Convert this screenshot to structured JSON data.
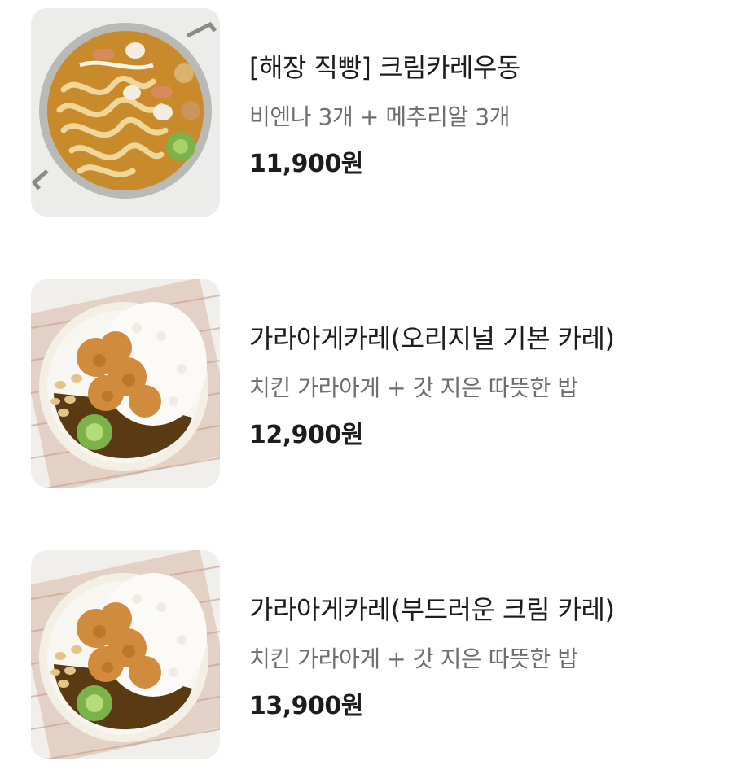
{
  "menu": {
    "items": [
      {
        "name": "[해장 직빵] 크림카레우동",
        "description": "비엔나 3개 + 메추리알 3개",
        "price": "11,900원",
        "image_icon": "curry-udon-pan-photo"
      },
      {
        "name": "가라아게카레(오리지널 기본 카레)",
        "description": "치킨 가라아게 + 갓 지은 따뜻한 밥",
        "price": "12,900원",
        "image_icon": "karaage-curry-plate-photo"
      },
      {
        "name": "가라아게카레(부드러운 크림 카레)",
        "description": "치킨 가라아게 + 갓 지은 따뜻한 밥",
        "price": "13,900원",
        "image_icon": "karaage-curry-plate-photo"
      }
    ]
  }
}
